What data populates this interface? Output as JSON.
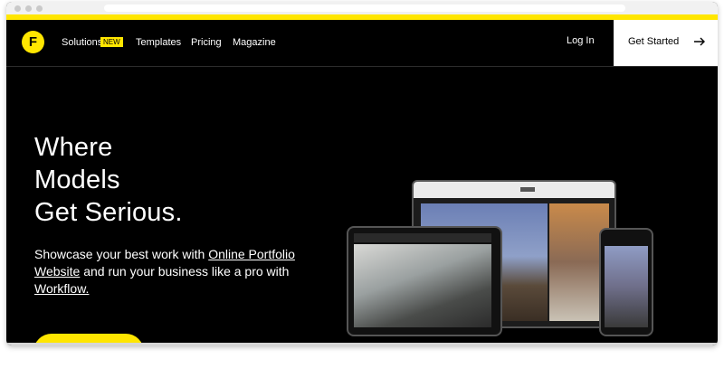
{
  "nav": {
    "logo_letter": "F",
    "links": [
      {
        "label": "Solutions"
      },
      {
        "label": "Templates"
      },
      {
        "label": "Pricing"
      },
      {
        "label": "Magazine"
      }
    ],
    "solutions_badge": "NEW",
    "login_label": "Log In",
    "get_started_label": "Get Started",
    "get_started_icon": "arrow-right-icon"
  },
  "hero": {
    "title_lines": [
      "Where",
      "Models",
      "Get Serious."
    ],
    "body_prefix": "Showcase your best work with ",
    "body_link1": "Online Portfolio Website",
    "body_middle": " and run your business like a pro with ",
    "body_link2": "Workflow."
  },
  "colors": {
    "accent": "#ffe600",
    "background": "#000000",
    "text": "#ffffff"
  }
}
